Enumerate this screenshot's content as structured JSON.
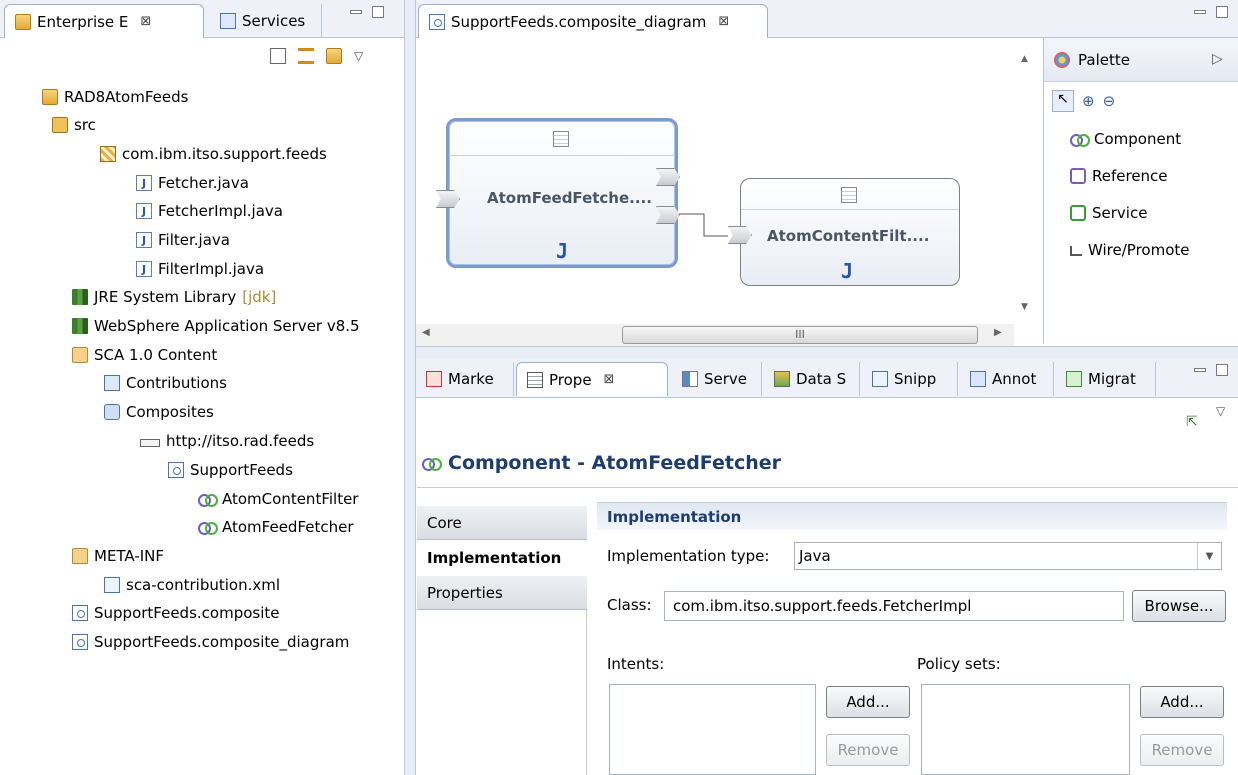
{
  "left_view": {
    "tabs": [
      {
        "label": "Enterprise E",
        "close": "⊠"
      },
      {
        "label": "Services"
      }
    ],
    "toolbar_icons": [
      "collapse-all-icon",
      "link-editor-icon",
      "new-project-icon",
      "view-menu-icon"
    ],
    "tree": [
      {
        "label": "RAD8AtomFeeds",
        "icon": "project-icon"
      },
      {
        "label": "src",
        "icon": "source-folder-icon"
      },
      {
        "label": "com.ibm.itso.support.feeds",
        "icon": "package-icon"
      },
      {
        "label": "Fetcher.java",
        "icon": "java-file-icon"
      },
      {
        "label": "FetcherImpl.java",
        "icon": "java-file-icon"
      },
      {
        "label": "Filter.java",
        "icon": "java-file-icon"
      },
      {
        "label": "FilterImpl.java",
        "icon": "java-file-icon"
      },
      {
        "label": "JRE System Library",
        "suffix": "[jdk]",
        "icon": "library-icon"
      },
      {
        "label": "WebSphere Application Server v8.5",
        "icon": "library-icon"
      },
      {
        "label": "SCA 1.0 Content",
        "icon": "sca-content-icon"
      },
      {
        "label": "Contributions",
        "icon": "contributions-icon"
      },
      {
        "label": "Composites",
        "icon": "composites-icon"
      },
      {
        "label": "http://itso.rad.feeds",
        "icon": "namespace-icon"
      },
      {
        "label": "SupportFeeds",
        "icon": "composite-icon"
      },
      {
        "label": "AtomContentFilter",
        "icon": "component-icon"
      },
      {
        "label": "AtomFeedFetcher",
        "icon": "component-icon"
      },
      {
        "label": "META-INF",
        "icon": "folder-icon"
      },
      {
        "label": "sca-contribution.xml",
        "icon": "xml-file-icon"
      },
      {
        "label": "SupportFeeds.composite",
        "icon": "composite-file-icon"
      },
      {
        "label": "SupportFeeds.composite_diagram",
        "icon": "diagram-file-icon"
      }
    ]
  },
  "editor": {
    "tab_label": "SupportFeeds.composite_diagram",
    "tab_close": "⊠",
    "components": [
      {
        "name": "AtomFeedFetche....",
        "impl_badge": "J"
      },
      {
        "name": "AtomContentFilt....",
        "impl_badge": "J"
      }
    ],
    "hscroll_label": "III"
  },
  "palette": {
    "title": "Palette",
    "collapse": "▷",
    "tools": [
      "select-icon",
      "zoom-in-icon",
      "zoom-out-icon"
    ],
    "items": [
      {
        "label": "Component",
        "icon": "component-icon"
      },
      {
        "label": "Reference",
        "icon": "reference-icon"
      },
      {
        "label": "Service",
        "icon": "service-icon"
      },
      {
        "label": "Wire/Promote",
        "icon": "wire-icon"
      }
    ]
  },
  "bottom_view": {
    "tabs": [
      {
        "label": "Marke"
      },
      {
        "label": "Prope",
        "close": "⊠"
      },
      {
        "label": "Serve"
      },
      {
        "label": "Data S"
      },
      {
        "label": "Snipp"
      },
      {
        "label": "Annot"
      },
      {
        "label": "Migrat"
      }
    ],
    "title": "Component - AtomFeedFetcher",
    "side_tabs": [
      "Core",
      "Implementation",
      "Properties"
    ],
    "section_title": "Implementation",
    "impl_type_label": "Implementation type:",
    "impl_type_value": "Java",
    "class_label": "Class:",
    "class_value": "com.ibm.itso.support.feeds.FetcherImpl",
    "browse_label": "Browse...",
    "intents_label": "Intents:",
    "policy_label": "Policy sets:",
    "add_label": "Add...",
    "remove_label": "Remove"
  },
  "colors": {
    "title_blue": "#1e3d6e",
    "selection_border": "#7b9bd0",
    "tab_background": "#eef2f8"
  }
}
